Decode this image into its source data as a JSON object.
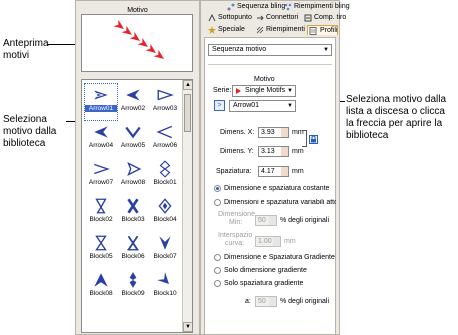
{
  "callouts": {
    "preview": "Anteprima\nmotivi",
    "library": "Seleziona\nmotivo dalla\nbiblioteca",
    "dropdown": "Seleziona motivo dalla\nlista a discesa o clicca\nla freccia per aprire la\nbiblioteca"
  },
  "left_panel": {
    "title": "Motivo",
    "library_items": [
      {
        "label": "Arrow01",
        "icon": "arrow01-motif-icon",
        "selected": true
      },
      {
        "label": "Arrow02",
        "icon": "arrow02-motif-icon"
      },
      {
        "label": "Arrow03",
        "icon": "arrow03-motif-icon"
      },
      {
        "label": "Arrow04",
        "icon": "arrow04-motif-icon"
      },
      {
        "label": "Arrow05",
        "icon": "arrow05-motif-icon"
      },
      {
        "label": "Arrow06",
        "icon": "arrow06-motif-icon"
      },
      {
        "label": "Arrow07",
        "icon": "arrow07-motif-icon"
      },
      {
        "label": "Arrow08",
        "icon": "arrow08-motif-icon"
      },
      {
        "label": "Block01",
        "icon": "block01-motif-icon"
      },
      {
        "label": "Block02",
        "icon": "block02-motif-icon"
      },
      {
        "label": "Block03",
        "icon": "block03-motif-icon"
      },
      {
        "label": "Block04",
        "icon": "block04-motif-icon"
      },
      {
        "label": "Block05",
        "icon": "block05-motif-icon"
      },
      {
        "label": "Block06",
        "icon": "block06-motif-icon"
      },
      {
        "label": "Block07",
        "icon": "block07-motif-icon"
      },
      {
        "label": "Block08",
        "icon": "block08-motif-icon"
      },
      {
        "label": "Block09",
        "icon": "block09-motif-icon"
      },
      {
        "label": "Block10",
        "icon": "block10-motif-icon"
      }
    ]
  },
  "tabs": {
    "row1": [
      "Sequenza bling",
      "Riempimenti bling"
    ],
    "row2": [
      "Sottopunto",
      "Connettori",
      "Comp. tiro"
    ],
    "row3": [
      "Speciale",
      "Riempimenti",
      "Profili"
    ],
    "active": "Profili"
  },
  "profile": {
    "type_dropdown": "Sequenza motivo",
    "group_title": "Motivo",
    "serie_label": "Serie:",
    "serie_value": "Single Motifs",
    "motif_value": "Arrow01",
    "open_library_button": ">",
    "size_x_label": "Dimens. X:",
    "size_x_value": "3.93",
    "size_y_label": "Dimens. Y:",
    "size_y_value": "3.13",
    "unit": "mm",
    "spacing_label": "Spaziatura:",
    "spacing_value": "4.17",
    "radio_const": "Dimensione e spaziatura costante",
    "radio_var": "Dimensioni e spaziatura variabili attorno a curve stre",
    "min_size_label_1": "Dimensione",
    "min_size_label_2": "Min:",
    "min_size_value": "50",
    "min_size_suffix": "% degli originali",
    "curve_gap_label_1": "Interspazio",
    "curve_gap_label_2": "curva:",
    "curve_gap_value": "1.00",
    "radio_grad_both": "Dimensione e Spaziatura Gradiente",
    "radio_grad_size": "Solo dimensione gradiente",
    "radio_grad_space": "Solo spaziatura gradiente",
    "to_label": "a:",
    "to_value": "50",
    "to_suffix": "% degli originali"
  },
  "colors": {
    "motif_red": "#e8202a",
    "motif_blue": "#2a3fa8",
    "selection": "#3a66c9"
  }
}
